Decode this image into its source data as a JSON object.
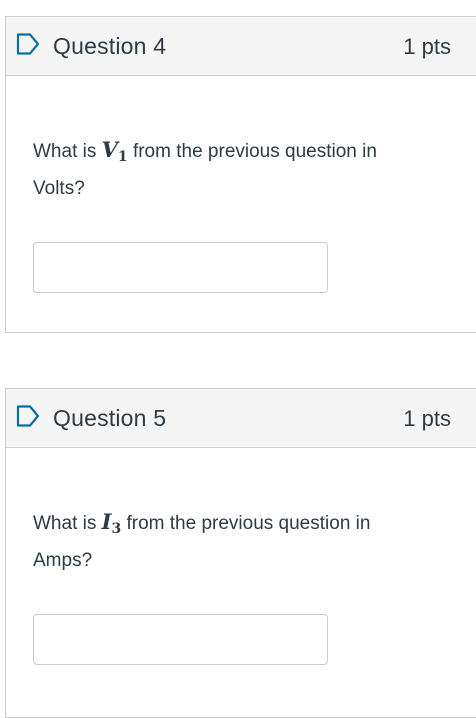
{
  "questions": [
    {
      "title": "Question 4",
      "points": "1 pts",
      "text_before": "What is ",
      "var_symbol": "V",
      "var_subscript": "1",
      "text_after": " from the previous question in Volts?",
      "answer_value": ""
    },
    {
      "title": "Question 5",
      "points": "1 pts",
      "text_before": "What is ",
      "var_symbol": "I",
      "var_subscript": "3",
      "text_after": " from the previous question in Amps?",
      "answer_value": ""
    }
  ],
  "colors": {
    "header_bg": "#f5f5f5",
    "border": "#c7cdd1",
    "text": "#2d3b45",
    "flag_icon": "#0770a3"
  },
  "icons": {
    "flag": "bookmark-flag-icon"
  }
}
